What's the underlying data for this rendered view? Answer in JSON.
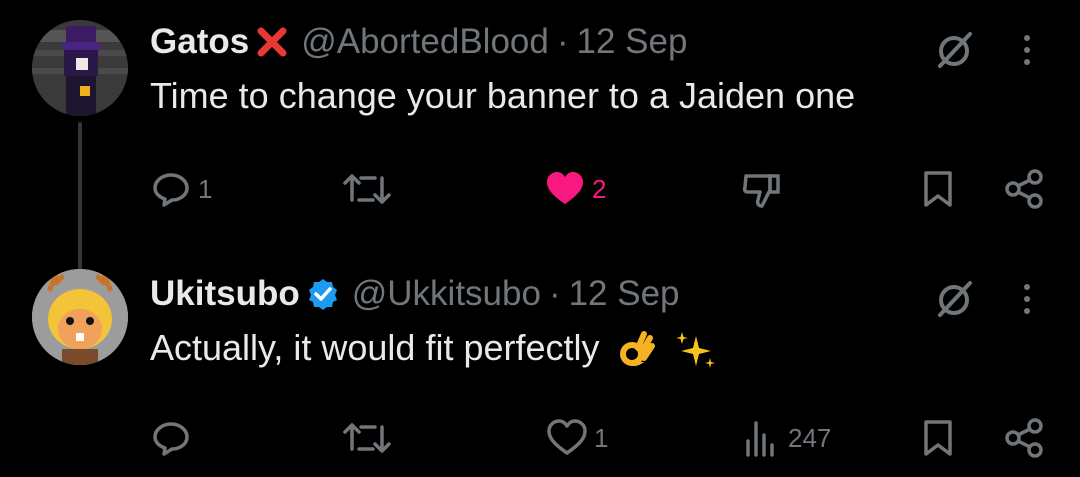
{
  "tweets": [
    {
      "name": "Gatos",
      "name_suffix_icon": "red-x-icon",
      "handle": "@AbortedBlood",
      "separator": "·",
      "date": "12 Sep",
      "text": "Time to change your banner to a Jaiden one",
      "reply_count": "1",
      "retweet_count": "",
      "like_count": "2",
      "liked": true,
      "accent_like_color": "#f91880"
    },
    {
      "name": "Ukitsubo",
      "verified_icon": "verified-badge-icon",
      "handle": "@Ukkitsubo",
      "separator": "·",
      "date": "12 Sep",
      "text": "Actually, it would fit perfectly",
      "emojis": [
        "ok-hand-icon",
        "sparkles-icon"
      ],
      "reply_count": "",
      "retweet_count": "",
      "like_count": "1",
      "views_count": "247"
    }
  ],
  "colors": {
    "background": "#000000",
    "text": "#e7e9ea",
    "secondary": "#71767b",
    "verified": "#1d9bf0",
    "like": "#f91880"
  }
}
